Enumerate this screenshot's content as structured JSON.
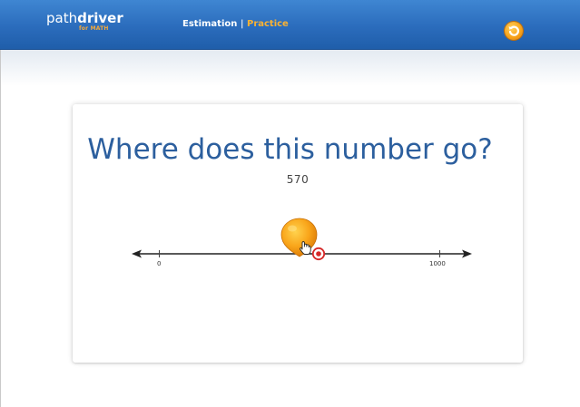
{
  "header": {
    "logo_word1": "path",
    "logo_word2": "driver",
    "logo_sub": "for MATH",
    "section": "Estimation",
    "separator": "|",
    "mode": "Practice",
    "refresh_icon": "refresh-icon"
  },
  "question": {
    "prompt": "Where does this number go?",
    "number": "570"
  },
  "number_line": {
    "min_label": "0",
    "max_label": "1000"
  },
  "icons": {
    "marker": "balloon-marker-icon",
    "cursor": "hand-cursor-icon",
    "target": "target-icon"
  },
  "colors": {
    "header_blue": "#2b6cbc",
    "accent_orange": "#f9a51a",
    "prompt_blue": "#2c5f9e",
    "target_red": "#d62828"
  }
}
